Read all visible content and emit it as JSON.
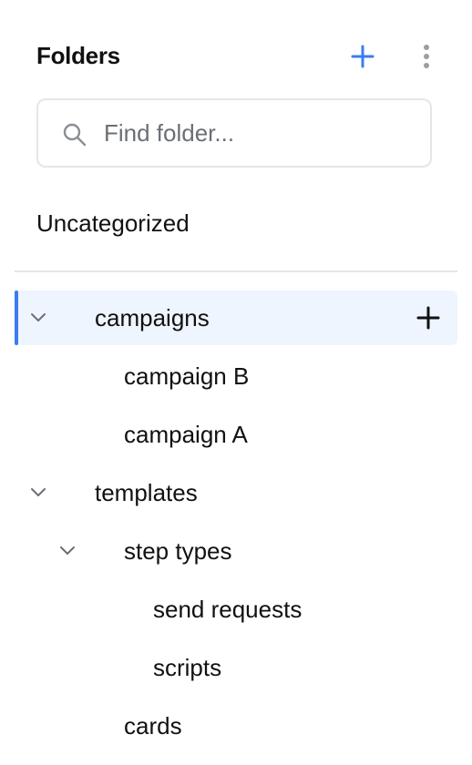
{
  "header": {
    "title": "Folders",
    "add_icon": "plus-icon",
    "more_icon": "kebab-icon"
  },
  "search": {
    "placeholder": "Find folder...",
    "value": "",
    "icon": "search-icon"
  },
  "uncategorized": {
    "label": "Uncategorized"
  },
  "tree": {
    "rows": [
      {
        "label": "campaigns",
        "expanded": true,
        "selected": true,
        "has_add": true
      },
      {
        "label": "campaign B"
      },
      {
        "label": "campaign A"
      },
      {
        "label": "templates",
        "expanded": true
      },
      {
        "label": "step types",
        "expanded": true
      },
      {
        "label": "send requests"
      },
      {
        "label": "scripts"
      },
      {
        "label": "cards"
      }
    ]
  },
  "colors": {
    "accent": "#3b7cf2",
    "selected_bg": "#eef5fe",
    "border": "#e4e6ea",
    "text": "#111111",
    "muted": "#6b6f76"
  }
}
